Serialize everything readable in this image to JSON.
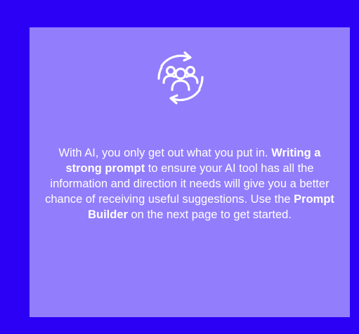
{
  "icon": {
    "name": "team-cycle-icon",
    "color": "#ffffff"
  },
  "colors": {
    "page_background": "#2b00f5",
    "card_background": "#927dfd",
    "text": "#ffffff"
  },
  "message": {
    "part1": "With AI, you only get out what you put in. ",
    "bold1": "Writing a strong prompt",
    "part2": " to ensure your AI tool has all the information and direction it needs will give you a better chance of receiving useful suggestions. Use the ",
    "bold2": "Prompt Builder",
    "part3": " on the next page to get started."
  }
}
